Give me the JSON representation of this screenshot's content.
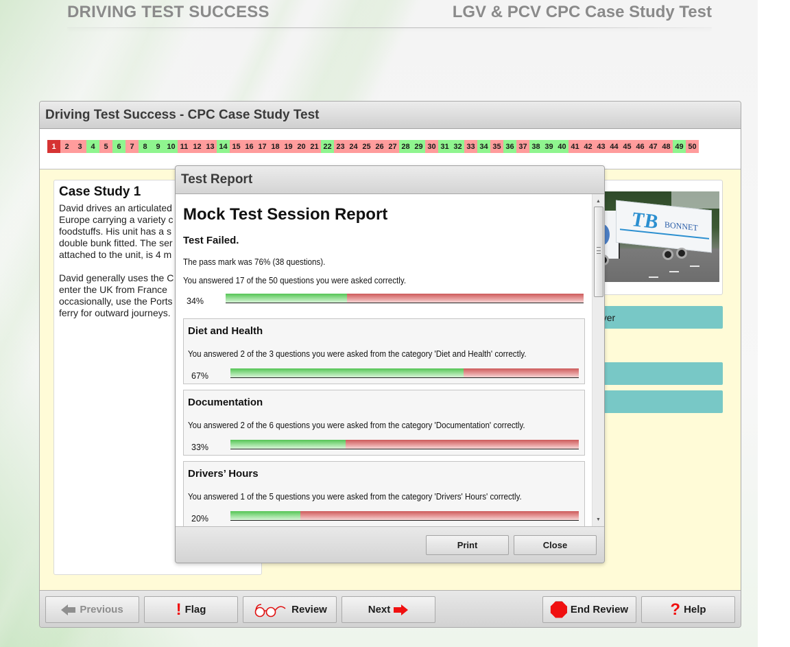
{
  "brand": {
    "left": "DRIVING TEST SUCCESS",
    "right": "LGV & PCV CPC Case Study Test"
  },
  "window": {
    "title": "Driving Test Success - CPC Case Study Test"
  },
  "question_nav": {
    "current": 1,
    "colors": {
      "correct": "#8ff58f",
      "wrong": "#ff9c9c",
      "current": "#d63333"
    },
    "items": [
      {
        "n": "1",
        "s": "cur"
      },
      {
        "n": "2",
        "s": "w"
      },
      {
        "n": "3",
        "s": "w"
      },
      {
        "n": "4",
        "s": "c"
      },
      {
        "n": "5",
        "s": "w"
      },
      {
        "n": "6",
        "s": "c"
      },
      {
        "n": "7",
        "s": "w"
      },
      {
        "n": "8",
        "s": "c"
      },
      {
        "n": "9",
        "s": "c"
      },
      {
        "n": "10",
        "s": "c"
      },
      {
        "n": "11",
        "s": "w"
      },
      {
        "n": "12",
        "s": "w"
      },
      {
        "n": "13",
        "s": "w"
      },
      {
        "n": "14",
        "s": "c"
      },
      {
        "n": "15",
        "s": "w"
      },
      {
        "n": "16",
        "s": "w"
      },
      {
        "n": "17",
        "s": "w"
      },
      {
        "n": "18",
        "s": "w"
      },
      {
        "n": "19",
        "s": "w"
      },
      {
        "n": "20",
        "s": "w"
      },
      {
        "n": "21",
        "s": "w"
      },
      {
        "n": "22",
        "s": "c"
      },
      {
        "n": "23",
        "s": "w"
      },
      {
        "n": "24",
        "s": "w"
      },
      {
        "n": "25",
        "s": "w"
      },
      {
        "n": "26",
        "s": "w"
      },
      {
        "n": "27",
        "s": "w"
      },
      {
        "n": "28",
        "s": "c"
      },
      {
        "n": "29",
        "s": "c"
      },
      {
        "n": "30",
        "s": "w"
      },
      {
        "n": "31",
        "s": "c"
      },
      {
        "n": "32",
        "s": "c"
      },
      {
        "n": "33",
        "s": "w"
      },
      {
        "n": "34",
        "s": "c"
      },
      {
        "n": "35",
        "s": "w"
      },
      {
        "n": "36",
        "s": "c"
      },
      {
        "n": "37",
        "s": "w"
      },
      {
        "n": "38",
        "s": "c"
      },
      {
        "n": "39",
        "s": "c"
      },
      {
        "n": "40",
        "s": "c"
      },
      {
        "n": "41",
        "s": "w"
      },
      {
        "n": "42",
        "s": "w"
      },
      {
        "n": "43",
        "s": "w"
      },
      {
        "n": "44",
        "s": "w"
      },
      {
        "n": "45",
        "s": "w"
      },
      {
        "n": "46",
        "s": "w"
      },
      {
        "n": "47",
        "s": "w"
      },
      {
        "n": "48",
        "s": "w"
      },
      {
        "n": "49",
        "s": "c"
      },
      {
        "n": "50",
        "s": "w"
      }
    ]
  },
  "case_study": {
    "title": "Case Study 1",
    "text": "David drives an articulated\nEurope carrying a variety c\nfoodstuffs. His unit has a s\ndouble bunk fitted. The ser\nattached to the unit, is 4 m\n\nDavid generally uses the C\nenter the UK from France \noccasionally, use the Ports\nferry for outward journeys."
  },
  "image": {
    "alt": "Articulated lorry - Transports Bonnet",
    "logo": "TB",
    "company": "BONNET"
  },
  "answers": [
    {
      "label": "river"
    },
    {
      "label": ""
    },
    {
      "label": ""
    }
  ],
  "toolbar": {
    "previous": "Previous",
    "flag": "Flag",
    "review": "Review",
    "next": "Next",
    "end_review": "End Review",
    "help": "Help"
  },
  "report": {
    "dialog_title": "Test Report",
    "title": "Mock Test Session Report",
    "result": "Test Failed.",
    "pass_mark_text": "The pass mark was 76% (38 questions).",
    "overall_text": "You answered 17 of the 50 questions you were asked correctly.",
    "overall_percent": 34,
    "overall_percent_label": "34%",
    "categories": [
      {
        "name": "Diet and Health",
        "text": "You answered 2 of the 3 questions you were asked from the category 'Diet and Health' correctly.",
        "percent": 67,
        "percent_label": "67%"
      },
      {
        "name": "Documentation",
        "text": "You answered 2 of the 6 questions you were asked from the category 'Documentation' correctly.",
        "percent": 33,
        "percent_label": "33%"
      },
      {
        "name": "Drivers’ Hours",
        "text": "You answered 1 of the 5 questions you were asked from the category 'Drivers' Hours' correctly.",
        "percent": 20,
        "percent_label": "20%"
      }
    ],
    "print_label": "Print",
    "close_label": "Close"
  }
}
